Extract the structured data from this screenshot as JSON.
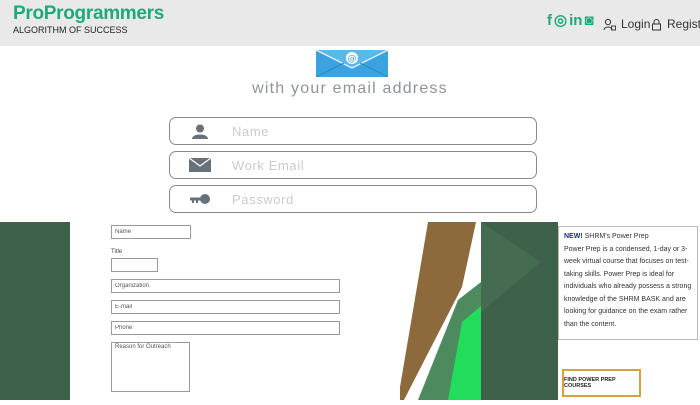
{
  "brand": {
    "name": "ProProgrammers",
    "tagline": "ALGORITHM OF SUCCESS"
  },
  "header": {
    "social_icons": [
      "facebook-icon",
      "instagram-icon",
      "linkedin-icon",
      "whatsapp-icon"
    ],
    "social_glyphs": [
      "f",
      "◎",
      "in",
      "◙"
    ],
    "login_label": "Login",
    "register_label": "Register"
  },
  "signup": {
    "heading": "with your email address",
    "name_placeholder": "Name",
    "email_placeholder": "Work Email",
    "password_placeholder": "Password"
  },
  "embedded_form": {
    "name_value": "Name",
    "title_label": "Title",
    "organization_value": "Organization",
    "email_value": "E-mail",
    "phone_value": "Phone",
    "reason_value": "Reason for Outreach"
  },
  "promo": {
    "new_label": "NEW!",
    "title": " SHRM's Power Prep",
    "body": "Power Prep is a condensed, 1-day or 3-week virtual course that focuses on test-taking skills. Power Prep is ideal for individuals who already possess a strong knowledge of the SHRM BASK and are looking for guidance on the exam rather than the content.",
    "cta_label": "FIND POWER PREP COURSES"
  },
  "colors": {
    "brand_green": "#1ea97c",
    "dark_green": "#3e6149",
    "accent_gold": "#d6a23b",
    "promo_blue": "#1a2b8a"
  }
}
